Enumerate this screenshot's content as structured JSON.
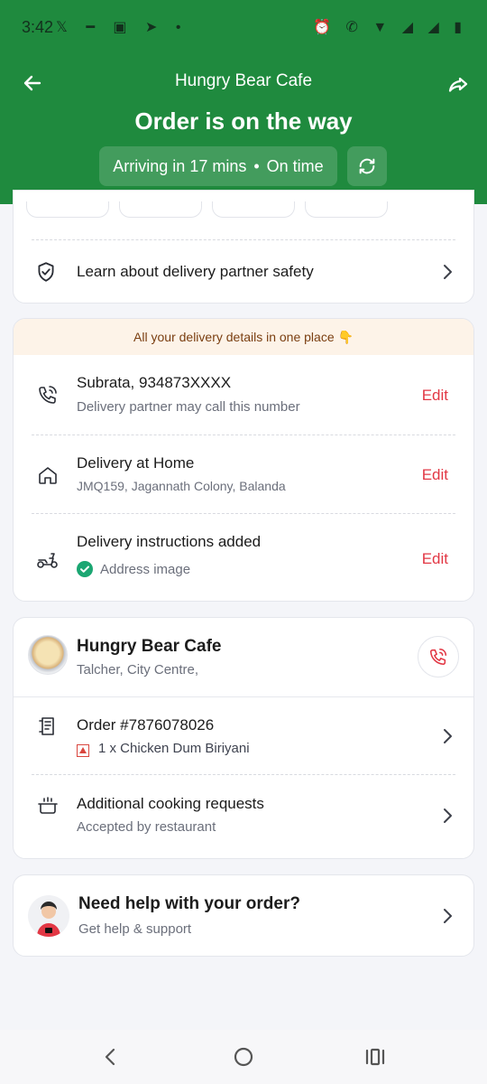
{
  "status_bar": {
    "time": "3:42",
    "left_icons": "𝕏 ━ ▣ ➤ •",
    "right_icons": "⏰ ✆ ▼ ◢ ◢ ▮"
  },
  "header": {
    "restaurant_name": "Hungry Bear Cafe",
    "order_status": "Order is on the way",
    "eta_text": "Arriving in 17 mins",
    "eta_separator": "•",
    "timeliness": "On time"
  },
  "safety": {
    "label": "Learn about delivery partner safety"
  },
  "delivery_details": {
    "banner": "All your delivery details in one place 👇",
    "contact": {
      "title": "Subrata, 934873XXXX",
      "subtitle": "Delivery partner may call this number",
      "edit": "Edit"
    },
    "address": {
      "title": "Delivery at Home",
      "subtitle": "JMQ159, Jagannath Colony, Balanda",
      "edit": "Edit"
    },
    "instructions": {
      "title": "Delivery instructions added",
      "subtitle": "Address image",
      "edit": "Edit"
    }
  },
  "restaurant": {
    "name": "Hungry Bear Cafe",
    "location": "Talcher, City Centre,",
    "order_title": "Order #7876078026",
    "order_item": "1 x Chicken Dum Biriyani",
    "cooking_title": "Additional cooking requests",
    "cooking_subtitle": "Accepted by restaurant"
  },
  "help": {
    "title": "Need help with your order?",
    "subtitle": "Get help & support"
  },
  "colors": {
    "brand_green": "#1f8a3e",
    "edit_red": "#e23744",
    "success_green": "#1ba672"
  },
  "icons": [
    "back-arrow-icon",
    "share-icon",
    "refresh-icon",
    "shield-check-icon",
    "phone-icon",
    "home-icon",
    "scooter-icon",
    "check-circle-icon",
    "phone-ring-icon",
    "receipt-icon",
    "cooking-pot-icon",
    "chevron-right-icon"
  ]
}
